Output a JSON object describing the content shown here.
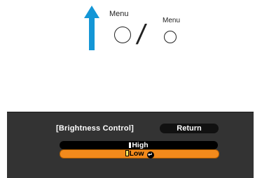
{
  "guide": {
    "menu_label_remote": "Menu",
    "menu_label_panel": "Menu",
    "arrow_color": "#1496d6",
    "icons": [
      "arrow-up-icon",
      "menu-button-icon"
    ]
  },
  "osd": {
    "title": "[Brightness Control]",
    "return_label": "Return",
    "options": [
      {
        "label": "High",
        "selected": false
      },
      {
        "label": "Low",
        "selected": true
      }
    ],
    "highlight_color": "#f28a1c"
  }
}
